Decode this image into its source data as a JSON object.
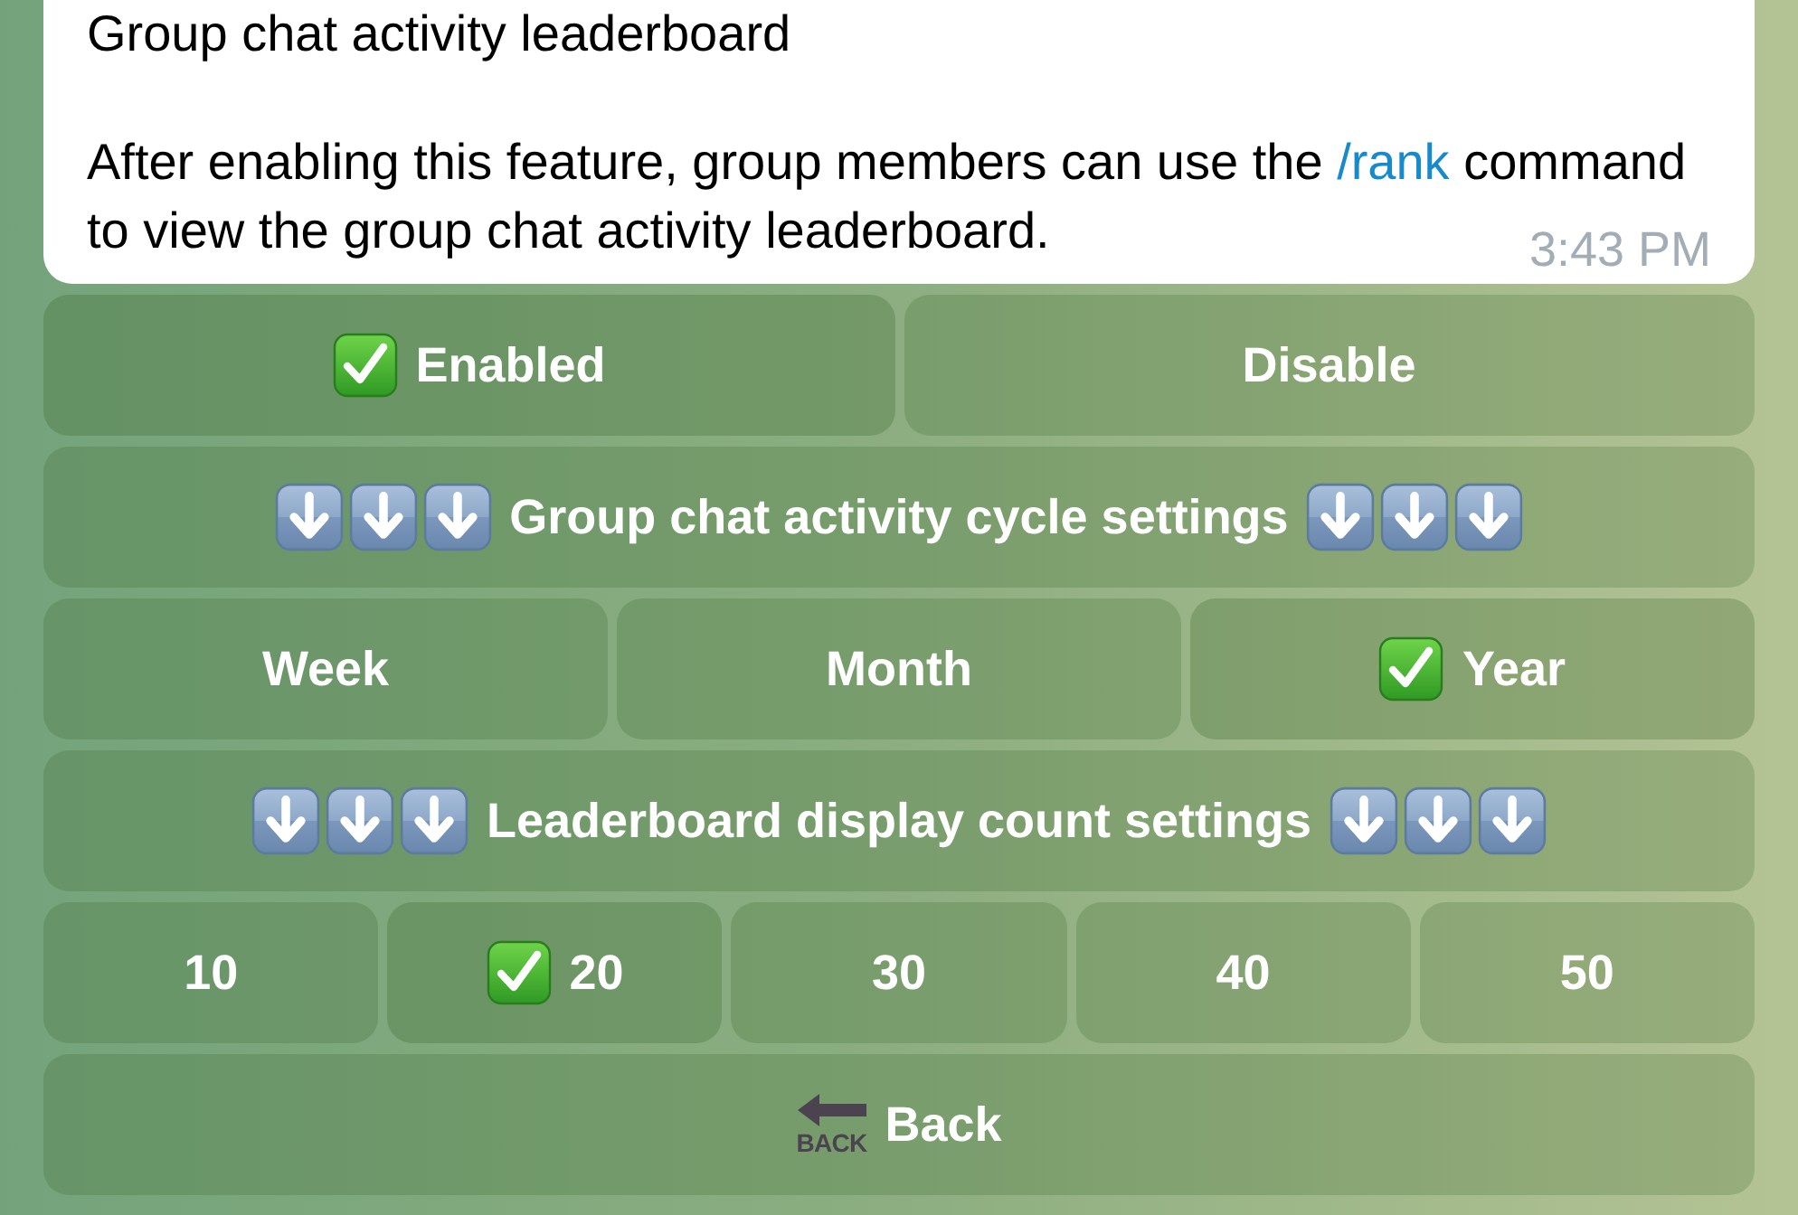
{
  "message": {
    "title": "Group chat activity leaderboard",
    "body_before": "After enabling this feature, group members can use the ",
    "command": "/rank",
    "body_after": " command to view the group chat activity leaderboard.",
    "time": "3:43 PM"
  },
  "keyboard": [
    {
      "kind": "options",
      "buttons": [
        {
          "label": "Enabled",
          "selected": true
        },
        {
          "label": "Disable",
          "selected": false
        }
      ]
    },
    {
      "kind": "section-header",
      "label": "Group chat activity cycle settings"
    },
    {
      "kind": "options",
      "buttons": [
        {
          "label": "Week",
          "selected": false
        },
        {
          "label": "Month",
          "selected": false
        },
        {
          "label": "Year",
          "selected": true
        }
      ]
    },
    {
      "kind": "section-header",
      "label": "Leaderboard display count settings"
    },
    {
      "kind": "options",
      "buttons": [
        {
          "label": "10",
          "selected": false
        },
        {
          "label": "20",
          "selected": true
        },
        {
          "label": "30",
          "selected": false
        },
        {
          "label": "40",
          "selected": false
        },
        {
          "label": "50",
          "selected": false
        }
      ]
    },
    {
      "kind": "back",
      "label": "Back",
      "icon_caption": "BACK"
    }
  ]
}
